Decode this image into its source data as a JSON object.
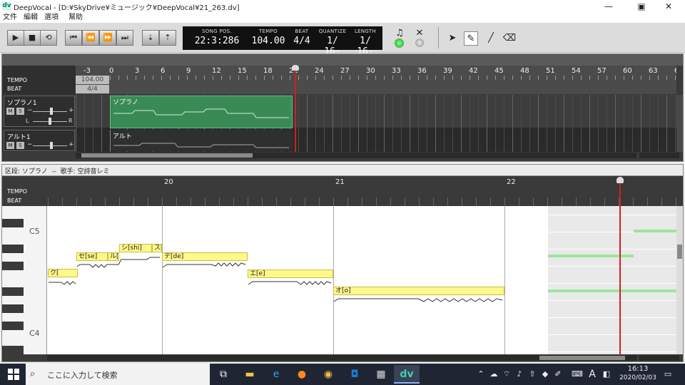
{
  "window": {
    "logo": "dv",
    "title": "DeepVocal - [D:¥SkyDrive¥ミュージック¥DeepVocal¥21_263.dv]",
    "controls": [
      "—",
      "▣",
      "✕"
    ]
  },
  "menu": [
    "文件",
    "編輯",
    "選項",
    "幫助"
  ],
  "transport": {
    "buttons": [
      "play-button",
      "stop-button",
      "loop-button",
      "goto-start-button",
      "rewind-button",
      "fast-forward-button",
      "goto-end-button",
      "tempo-down-button",
      "tempo-up-button"
    ]
  },
  "lcd": {
    "song_pos_label": "SONG POS.",
    "song_pos": "22:3:286",
    "tempo_label": "TEMPO",
    "tempo": "104.00",
    "beat_label": "BEAT",
    "beat": "4/4",
    "quantize_label": "QUANTIZE",
    "quantize": "1/ 16·",
    "length_label": "LENGTH",
    "length": "1/ 16·"
  },
  "tools": [
    "music-note-icon",
    "scissors-icon",
    "pointer-icon",
    "pencil-icon",
    "line-icon",
    "eraser-icon"
  ],
  "track_view": {
    "ruler": [
      "-3",
      "0",
      "3",
      "6",
      "9",
      "12",
      "15",
      "18",
      "21",
      "24",
      "27",
      "30",
      "33",
      "36",
      "39",
      "42",
      "45",
      "48",
      "51",
      "54",
      "57",
      "60",
      "63",
      "6("
    ],
    "tempo_label": "TEMPO",
    "beat_label": "BEAT",
    "tempo_value": "104.00",
    "beat_value": "4/4",
    "tracks": [
      {
        "name": "ソプラノ1",
        "part": "ソプラノ"
      },
      {
        "name": "アルト1",
        "part": "アルト"
      }
    ],
    "pan_left": "L",
    "pan_right": "R",
    "vol_minus": "−",
    "vol_plus": "+",
    "mute": "M",
    "solo": "S"
  },
  "piano_roll": {
    "header": "区段: ソプラノ  --  歌手: 空詩音レミ",
    "tempo_label": "TEMPO",
    "beat_label": "BEAT",
    "measures": [
      "20",
      "21",
      "22"
    ],
    "keys": [
      "C5",
      "C4"
    ],
    "notes": [
      {
        "lyric": "ク[",
        "pitch": 0.42
      },
      {
        "lyric": "セ[se]",
        "pitch": 0.62
      },
      {
        "lyric": "ル[",
        "pitch": 0.62
      },
      {
        "lyric": "シ[shi]",
        "pitch": 0.72
      },
      {
        "lyric": "ス[",
        "pitch": 0.72
      },
      {
        "lyric": "デ[de]",
        "pitch": 0.62
      },
      {
        "lyric": "エ[e]",
        "pitch": 0.42
      },
      {
        "lyric": "オ[o]",
        "pitch": 0.22
      }
    ]
  },
  "taskbar": {
    "search_placeholder": "ここに入力して検索",
    "time": "16:13",
    "date": "2020/02/03",
    "ime": "A"
  },
  "colors": {
    "part_green": "#3a8a55",
    "note_yellow": "#fff88a",
    "playhead": "#d02020"
  }
}
